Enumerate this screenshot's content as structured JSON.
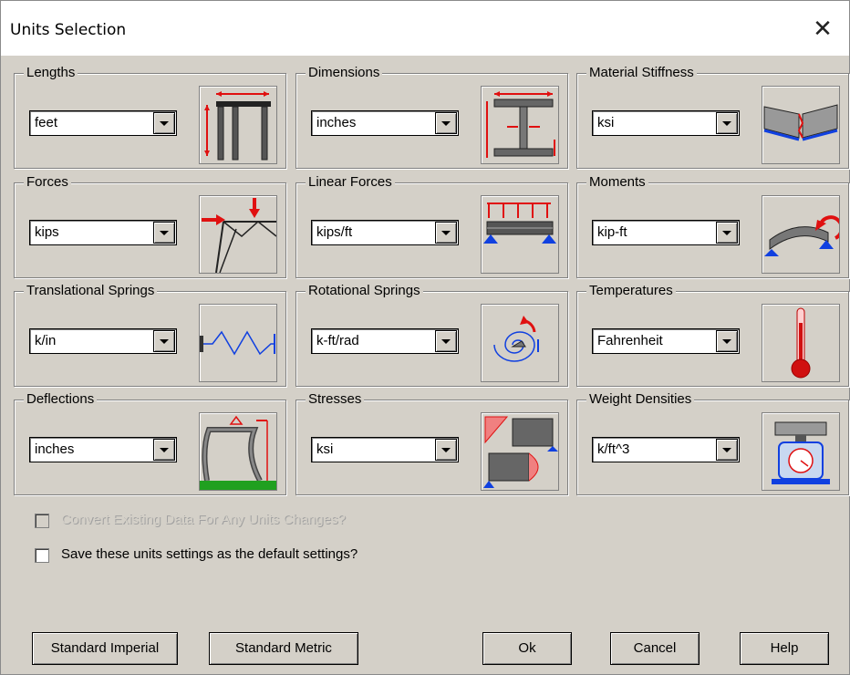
{
  "window": {
    "title": "Units Selection",
    "close_glyph": "✕"
  },
  "groups": [
    {
      "label": "Lengths",
      "value": "feet",
      "icon": "frame-length-icon"
    },
    {
      "label": "Dimensions",
      "value": "inches",
      "icon": "i-beam-dimension-icon"
    },
    {
      "label": "Material Stiffness",
      "value": "ksi",
      "icon": "bending-stiffness-icon"
    },
    {
      "label": "Forces",
      "value": "kips",
      "icon": "truss-force-icon"
    },
    {
      "label": "Linear Forces",
      "value": "kips/ft",
      "icon": "distributed-load-icon"
    },
    {
      "label": "Moments",
      "value": "kip-ft",
      "icon": "beam-moment-icon"
    },
    {
      "label": "Translational Springs",
      "value": "k/in",
      "icon": "spring-icon"
    },
    {
      "label": "Rotational Springs",
      "value": "k-ft/rad",
      "icon": "rotational-spring-icon"
    },
    {
      "label": "Temperatures",
      "value": "Fahrenheit",
      "icon": "thermometer-icon"
    },
    {
      "label": "Deflections",
      "value": "inches",
      "icon": "deflected-frame-icon"
    },
    {
      "label": "Stresses",
      "value": "ksi",
      "icon": "stress-diagram-icon"
    },
    {
      "label": "Weight Densities",
      "value": "k/ft^3",
      "icon": "scale-icon"
    }
  ],
  "options": {
    "convert_label": "Convert Existing Data For Any Units Changes?",
    "convert_enabled": false,
    "save_default_label": "Save these units settings as the default settings?",
    "save_default_checked": false
  },
  "buttons": {
    "standard_imperial": "Standard Imperial",
    "standard_metric": "Standard Metric",
    "ok": "Ok",
    "cancel": "Cancel",
    "help": "Help"
  },
  "colors": {
    "accent_red": "#e01010",
    "support_blue": "#1040e0",
    "ground_green": "#20a020"
  }
}
